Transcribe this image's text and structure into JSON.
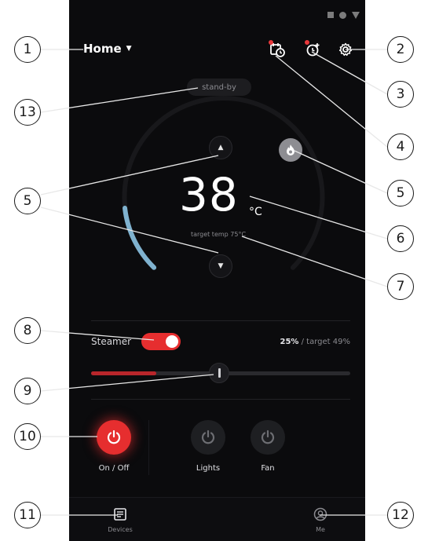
{
  "header": {
    "title": "Home"
  },
  "status_text": "stand-by",
  "temperature": {
    "value": "38",
    "unit": "°C",
    "target_label": "target temp 75°C"
  },
  "steamer": {
    "label": "Steamer",
    "on": true,
    "value_text": "25%",
    "target_text": " / target 49%",
    "level": 0.25
  },
  "controls": [
    {
      "label": "On / Off",
      "active": true
    },
    {
      "label": "Lights",
      "active": false
    },
    {
      "label": "Fan",
      "active": false
    }
  ],
  "nav": {
    "devices_label": "Devices",
    "me_label": "Me"
  },
  "callouts": [
    "1",
    "2",
    "3",
    "4",
    "5",
    "6",
    "7",
    "8",
    "9",
    "10",
    "11",
    "12",
    "13",
    "5",
    "5"
  ],
  "colors": {
    "accent": "#e62e2f",
    "background": "#0b0b0d",
    "dial_blue": "#7fb2cf",
    "muted": "#8b8b90"
  },
  "icons": [
    "calendar-clock-icon",
    "alarm-add-icon",
    "gear-icon",
    "flame-icon",
    "power-icon",
    "chevron-up-icon",
    "chevron-down-icon",
    "devices-icon",
    "user-icon"
  ]
}
